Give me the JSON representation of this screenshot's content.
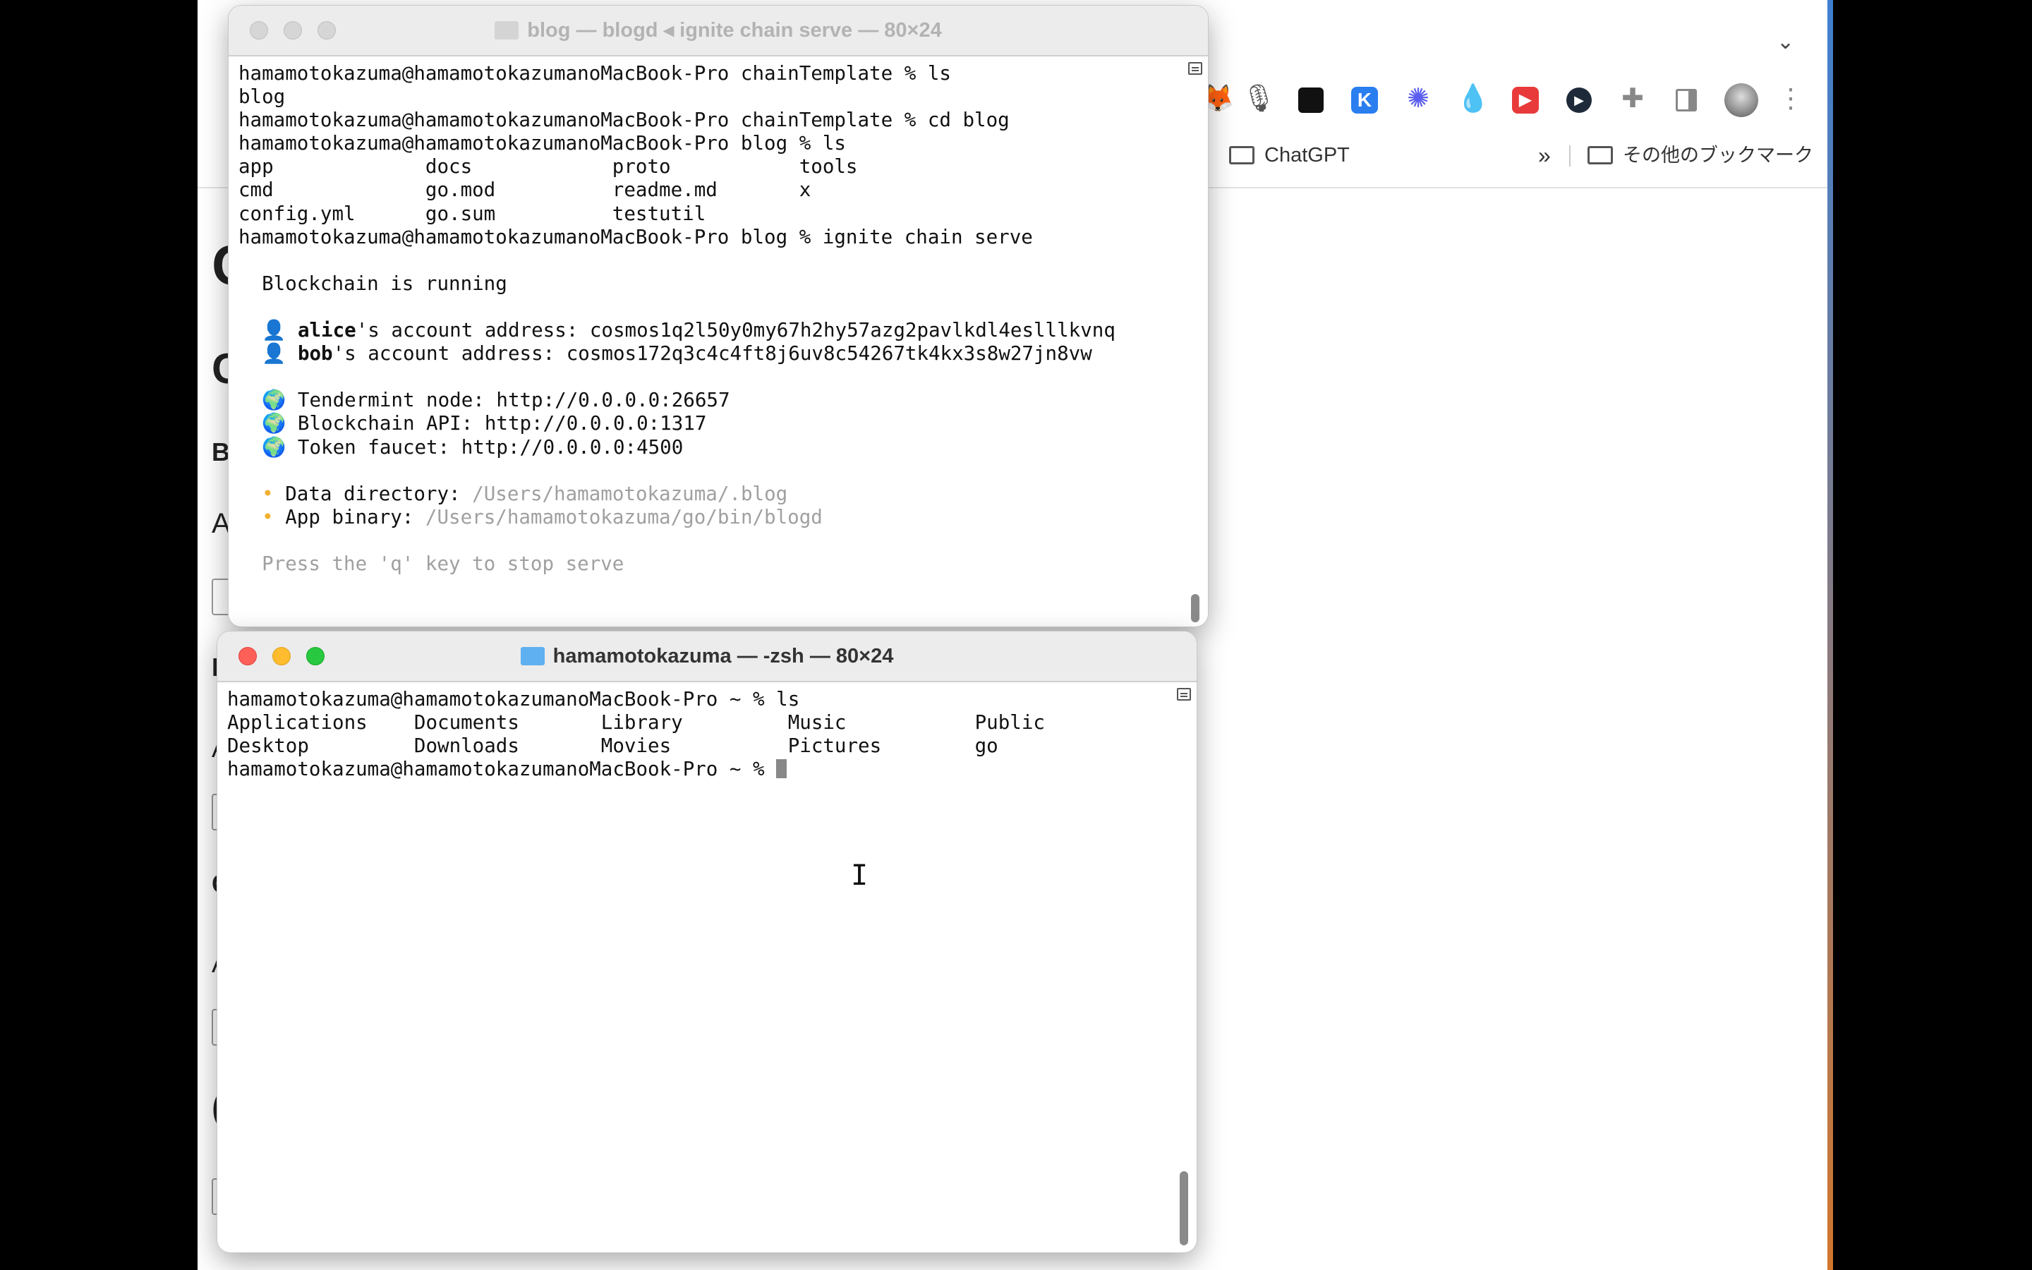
{
  "browser": {
    "bookmarks": {
      "folder1": "ChatGPT",
      "overflow": "»",
      "other": "その他のブックマーク"
    },
    "page_letters": [
      "C",
      "C",
      "B",
      "A",
      "I",
      "A",
      "C",
      "A",
      "("
    ],
    "extensions": [
      "fox-icon",
      "mic-icon",
      "apps-grid-icon",
      "k-icon",
      "asterisk-icon",
      "droplet-icon",
      "play-icon",
      "shield-play-icon",
      "puzzle-icon",
      "sidepanel-icon",
      "profile-avatar",
      "more-icon"
    ]
  },
  "terminal1": {
    "title": "blog — blogd ◂ ignite chain serve — 80×24",
    "state": "inactive",
    "lines": [
      {
        "segments": [
          {
            "t": "hamamotokazuma@hamamotokazumanoMacBook-Pro chainTemplate % ls"
          }
        ]
      },
      {
        "segments": [
          {
            "t": "blog"
          }
        ]
      },
      {
        "segments": [
          {
            "t": "hamamotokazuma@hamamotokazumanoMacBook-Pro chainTemplate % cd blog"
          }
        ]
      },
      {
        "segments": [
          {
            "t": "hamamotokazuma@hamamotokazumanoMacBook-Pro blog % ls"
          }
        ]
      },
      {
        "segments": [
          {
            "t": "app             docs            proto           tools"
          }
        ]
      },
      {
        "segments": [
          {
            "t": "cmd             go.mod          readme.md       x"
          }
        ]
      },
      {
        "segments": [
          {
            "t": "config.yml      go.sum          testutil"
          }
        ]
      },
      {
        "segments": [
          {
            "t": "hamamotokazuma@hamamotokazumanoMacBook-Pro blog % ignite chain serve"
          }
        ]
      },
      {
        "segments": [
          {
            "t": ""
          }
        ]
      },
      {
        "segments": [
          {
            "t": "  Blockchain is running"
          }
        ]
      },
      {
        "segments": [
          {
            "t": ""
          }
        ]
      },
      {
        "segments": [
          {
            "t": "  "
          },
          {
            "t": "👤",
            "c": "emoji person"
          },
          {
            "t": " "
          },
          {
            "t": "alice",
            "c": "bold"
          },
          {
            "t": "'s account address: cosmos1q2l50y0my67h2hy57azg2pavlkdl4eslllkvnq"
          }
        ]
      },
      {
        "segments": [
          {
            "t": "  "
          },
          {
            "t": "👤",
            "c": "emoji person"
          },
          {
            "t": " "
          },
          {
            "t": "bob",
            "c": "bold"
          },
          {
            "t": "'s account address: cosmos172q3c4c4ft8j6uv8c54267tk4kx3s8w27jn8vw"
          }
        ]
      },
      {
        "segments": [
          {
            "t": ""
          }
        ]
      },
      {
        "segments": [
          {
            "t": "  "
          },
          {
            "t": "🌍",
            "c": "emoji globe"
          },
          {
            "t": " Tendermint node: http://0.0.0.0:26657"
          }
        ]
      },
      {
        "segments": [
          {
            "t": "  "
          },
          {
            "t": "🌍",
            "c": "emoji globe"
          },
          {
            "t": " Blockchain API: http://0.0.0.0:1317"
          }
        ]
      },
      {
        "segments": [
          {
            "t": "  "
          },
          {
            "t": "🌍",
            "c": "emoji globe"
          },
          {
            "t": " Token faucet: http://0.0.0.0:4500"
          }
        ]
      },
      {
        "segments": [
          {
            "t": ""
          }
        ]
      },
      {
        "segments": [
          {
            "t": "  "
          },
          {
            "t": "•",
            "c": "bullet"
          },
          {
            "t": " Data directory: "
          },
          {
            "t": "/Users/hamamotokazuma/.blog",
            "c": "dim"
          }
        ]
      },
      {
        "segments": [
          {
            "t": "  "
          },
          {
            "t": "•",
            "c": "bullet"
          },
          {
            "t": " App binary: "
          },
          {
            "t": "/Users/hamamotokazuma/go/bin/blogd",
            "c": "dim"
          }
        ]
      },
      {
        "segments": [
          {
            "t": ""
          }
        ]
      },
      {
        "segments": [
          {
            "t": "  Press the 'q' key to stop serve",
            "c": "dim"
          }
        ]
      }
    ]
  },
  "terminal2": {
    "title": "hamamotokazuma — -zsh — 80×24",
    "state": "active",
    "lines": [
      {
        "segments": [
          {
            "t": "hamamotokazuma@hamamotokazumanoMacBook-Pro ~ % ls"
          }
        ]
      },
      {
        "segments": [
          {
            "t": "Applications    Documents       Library         Music           Public"
          }
        ]
      },
      {
        "segments": [
          {
            "t": "Desktop         Downloads       Movies          Pictures        go"
          }
        ]
      },
      {
        "segments": [
          {
            "t": "hamamotokazuma@hamamotokazumanoMacBook-Pro ~ % "
          }
        ]
      }
    ]
  }
}
